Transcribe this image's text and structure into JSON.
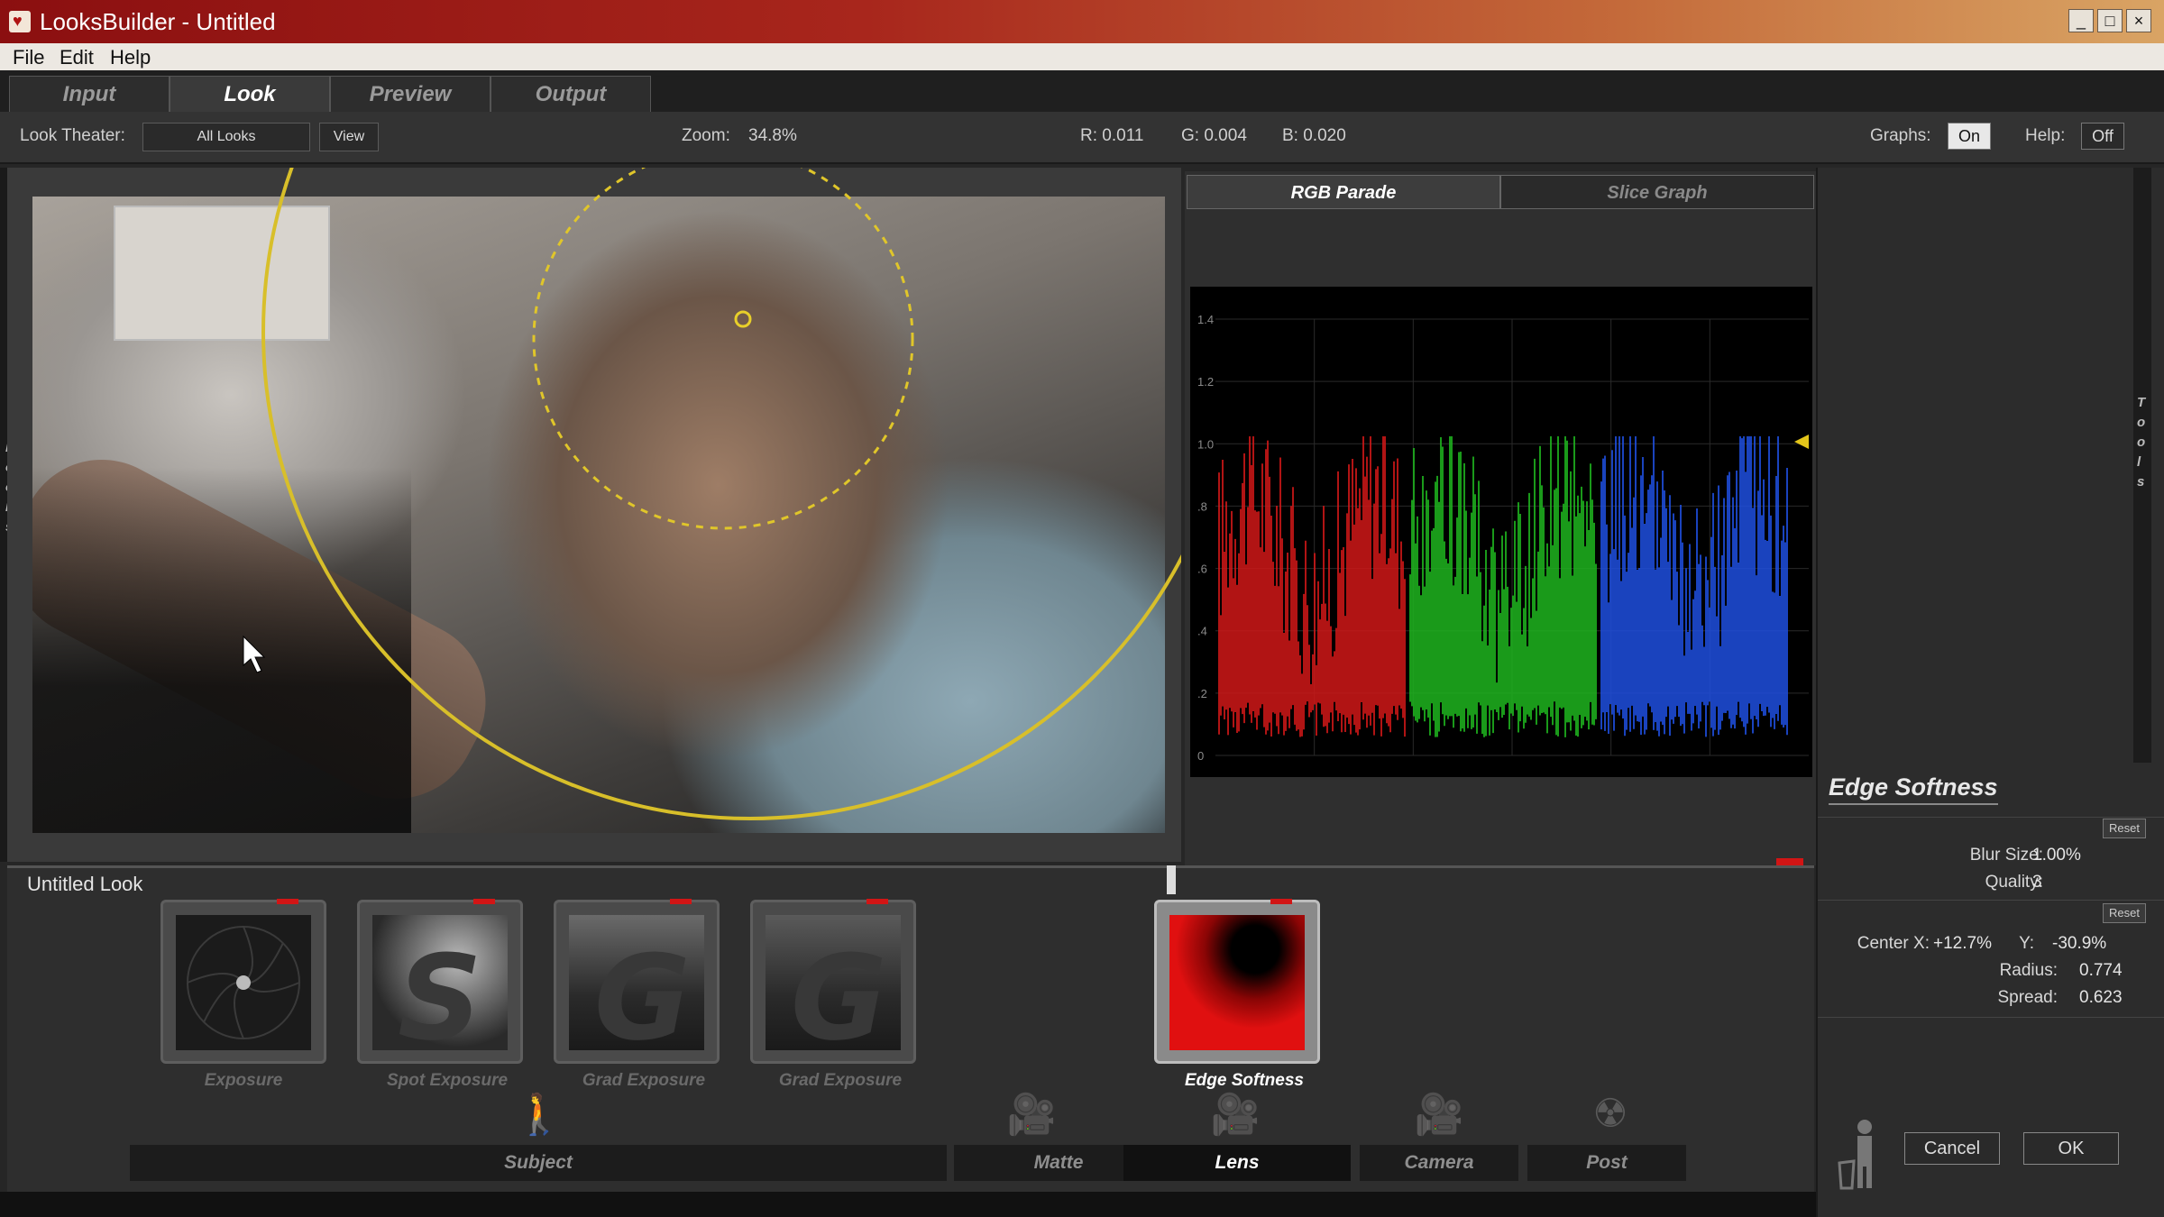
{
  "window": {
    "title": "LooksBuilder - Untitled"
  },
  "menu": [
    "File",
    "Edit",
    "Help"
  ],
  "tabs": [
    {
      "label": "Input",
      "active": false
    },
    {
      "label": "Look",
      "active": true
    },
    {
      "label": "Preview",
      "active": false
    },
    {
      "label": "Output",
      "active": false
    }
  ],
  "toolbar": {
    "look_theater_label": "Look Theater:",
    "look_theater_value": "All Looks",
    "view_button": "View",
    "zoom_label": "Zoom:",
    "zoom_value": "34.8%",
    "r_readout": "R: 0.011",
    "g_readout": "G: 0.004",
    "b_readout": "B: 0.020",
    "graphs_label": "Graphs:",
    "graphs_value": "On",
    "help_label": "Help:",
    "help_value": "Off"
  },
  "side_tabs": {
    "left": "Looks",
    "right": "Tools"
  },
  "graph": {
    "tabs": [
      {
        "label": "RGB Parade",
        "active": true
      },
      {
        "label": "Slice Graph",
        "active": false
      }
    ],
    "y_ticks": [
      "1.4",
      "1.2",
      "1.0",
      ".8",
      ".6",
      ".4",
      ".2",
      "0"
    ],
    "colors": {
      "red": "#d01818",
      "green": "#1fb51f",
      "blue": "#1f4fe0",
      "marker": "#e3c51a"
    }
  },
  "tool_panel": {
    "title": "Edge Softness",
    "reset_label": "Reset",
    "blur_size_label": "Blur Size:",
    "blur_size_value": "1.00%",
    "quality_label": "Quality:",
    "quality_value": "3",
    "center_x_label": "Center X:",
    "center_x_value": "+12.7%",
    "y_label": "Y:",
    "y_value": "-30.9%",
    "radius_label": "Radius:",
    "radius_value": "0.774",
    "spread_label": "Spread:",
    "spread_value": "0.623",
    "cancel_button": "Cancel",
    "ok_button": "OK"
  },
  "look": {
    "title": "Untitled Look",
    "tools": [
      "Exposure",
      "Spot Exposure",
      "Grad Exposure",
      "Grad Exposure",
      "Edge Softness"
    ],
    "selected_tool": "Edge Softness"
  },
  "categories": [
    {
      "label": "Subject",
      "active": false
    },
    {
      "label": "Matte",
      "active": false
    },
    {
      "label": "Lens",
      "active": true
    },
    {
      "label": "Camera",
      "active": false
    },
    {
      "label": "Post",
      "active": false
    }
  ]
}
